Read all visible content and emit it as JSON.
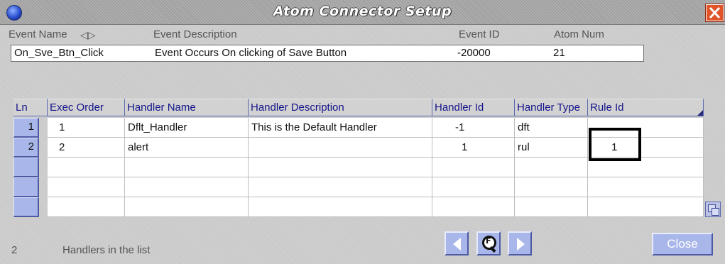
{
  "window": {
    "title": "Atom Connector Setup",
    "close_icon": "close-icon"
  },
  "event_header": {
    "event_name_label": "Event Name",
    "sort_icon": "◁▷",
    "event_description_label": "Event Description",
    "event_id_label": "Event ID",
    "atom_num_label": "Atom Num"
  },
  "event": {
    "name": "On_Sve_Btn_Click",
    "description": "Event Occurs On clicking of Save Button",
    "id": "-20000",
    "atom_num": "21"
  },
  "grid": {
    "columns": [
      "Ln",
      "Exec Order",
      "Handler Name",
      "Handler Description",
      "Handler Id",
      "Handler Type",
      "Rule Id"
    ],
    "rows": [
      {
        "ln": "1",
        "exec_order": "1",
        "handler_name": "Dflt_Handler",
        "handler_description": "This is the Default Handler",
        "handler_id": "-1",
        "handler_type": "dft",
        "rule_id": ""
      },
      {
        "ln": "2",
        "exec_order": "2",
        "handler_name": "alert",
        "handler_description": "",
        "handler_id": "1",
        "handler_type": "rul",
        "rule_id": "1"
      },
      {
        "ln": "",
        "exec_order": "",
        "handler_name": "",
        "handler_description": "",
        "handler_id": "",
        "handler_type": "",
        "rule_id": ""
      },
      {
        "ln": "",
        "exec_order": "",
        "handler_name": "",
        "handler_description": "",
        "handler_id": "",
        "handler_type": "",
        "rule_id": ""
      },
      {
        "ln": "",
        "exec_order": "",
        "handler_name": "",
        "handler_description": "",
        "handler_id": "",
        "handler_type": "",
        "rule_id": ""
      }
    ]
  },
  "footer": {
    "count": "2",
    "count_label": "Handlers in the list",
    "close_label": "Close"
  },
  "colors": {
    "header_text": "#14148a",
    "row_header_fill": "#a9b6e9",
    "close_x": "#e05428"
  }
}
